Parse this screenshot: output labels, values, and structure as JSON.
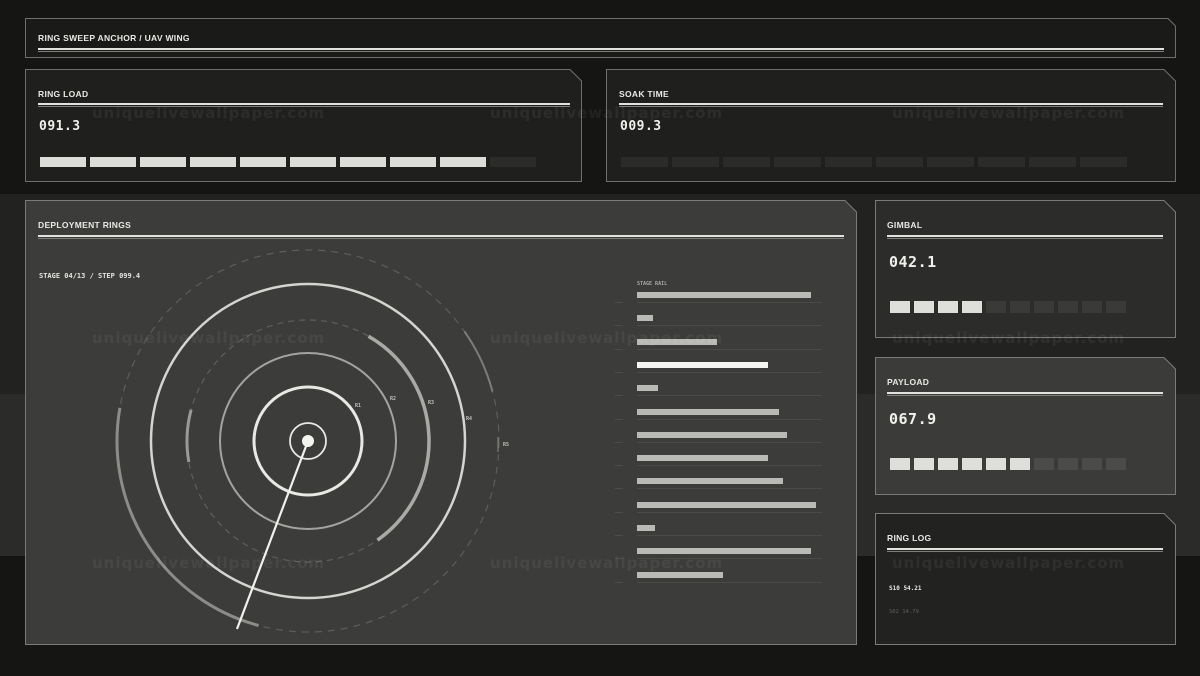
{
  "header": {
    "title": "RING SWEEP ANCHOR / UAV WING"
  },
  "ring_load": {
    "title": "RING LOAD",
    "value": "091.3",
    "level_segments": 9,
    "total_segments": 10
  },
  "soak_time": {
    "title": "SOAK TIME",
    "value": "009.3",
    "level_segments": 0,
    "total_segments": 10
  },
  "deployment": {
    "title": "DEPLOYMENT RINGS",
    "stage_label": "STAGE 04/13 / STEP 099.4",
    "ring_labels": [
      "R1",
      "R2",
      "R3",
      "R4",
      "R5"
    ],
    "stage_rail": {
      "title": "STAGE RAIL",
      "bars": [
        0.89,
        0.08,
        0.41,
        0.67,
        0.11,
        0.73,
        0.77,
        0.67,
        0.75,
        0.92,
        0.09,
        0.89,
        0.44
      ],
      "highlight_index": 3
    }
  },
  "gimbal": {
    "title": "GIMBAL",
    "value": "042.1",
    "level_segments": 4,
    "total_segments": 10
  },
  "payload": {
    "title": "PAYLOAD",
    "value": "067.9",
    "level_segments": 6,
    "total_segments": 10
  },
  "ring_log": {
    "title": "RING LOG",
    "entries": [
      "S10 54.21",
      "S02 14.79"
    ]
  },
  "watermark": "uniquelivewallpaper.com",
  "colors": {
    "background": "#151614",
    "panel_dark": "#1f201e",
    "panel_mid": "#3c3d3a",
    "accent": "#e6e6e2"
  }
}
